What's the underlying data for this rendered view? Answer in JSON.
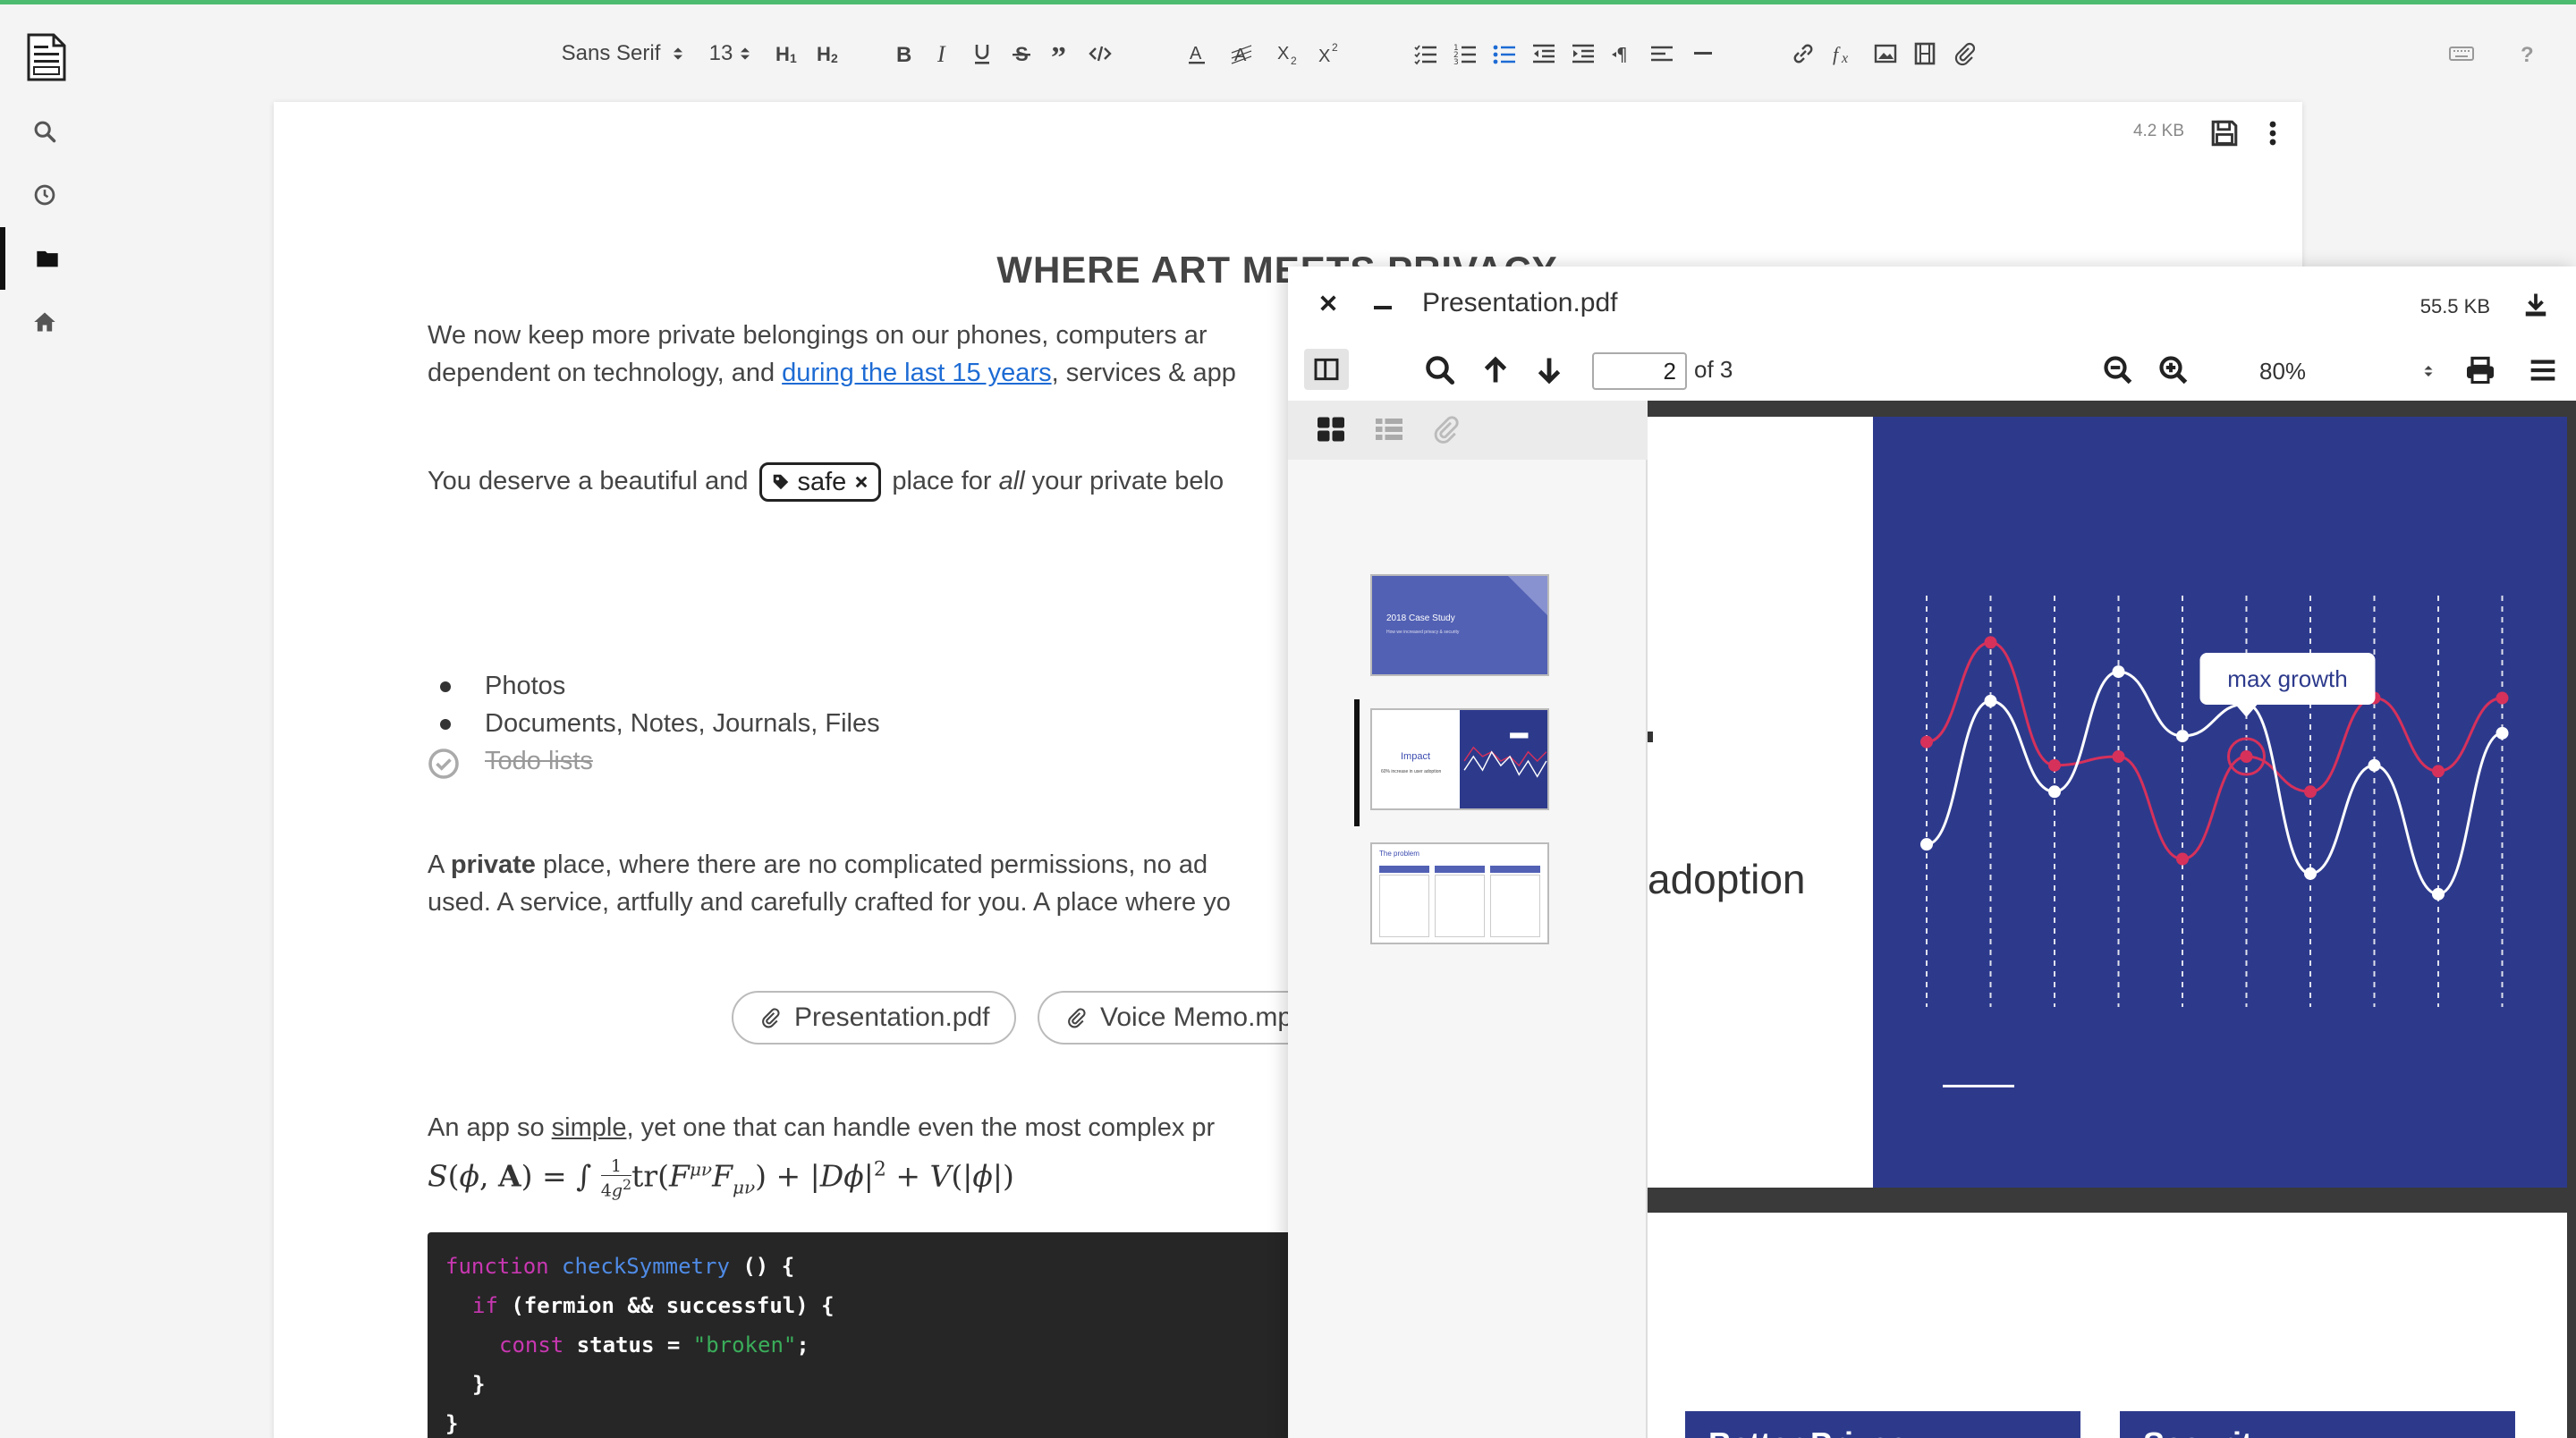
{
  "toolbar": {
    "font_family": "Sans Serif",
    "font_size": "13",
    "zoom_icon_names": [
      "keyboard-icon",
      "help-icon"
    ]
  },
  "document": {
    "size": "4.2 KB",
    "title": "WHERE ART MEETS PRIVACY",
    "para1_line1": "We now keep more private belongings on our phones, computers ar",
    "para1_line2_pre": "dependent on technology, and ",
    "para1_link": "during the last 15 years",
    "para1_line2_post": ", services & app",
    "para2_pre": "You deserve a beautiful and",
    "para2_tag": "safe",
    "para2_mid": "place for ",
    "para2_em": "all",
    "para2_post": " your private belo",
    "list": [
      "Photos",
      "Documents, Notes, Journals, Files"
    ],
    "done_item": "Todo lists",
    "para3_pre": "A ",
    "para3_bold": "private",
    "para3_post": " place, where there are no complicated permissions, no ad",
    "para3_line2": "used. A service, artfully and carefully crafted for you. A place where yo",
    "attachments": [
      "Presentation.pdf",
      "Voice Memo.mp"
    ],
    "para4_pre": "An app so ",
    "para4_u": "simple",
    "para4_post": ", yet one that can handle even the most complex pr",
    "code": {
      "l1_kw": "function",
      "l1_fn": "checkSymmetry",
      "l1_rest": " () {",
      "l2_kw": "if",
      "l2_rest": " (fermion && successful) {",
      "l3_kw": "const",
      "l3_var": " status = ",
      "l3_str": "\"broken\"",
      "l3_end": ";",
      "l4": "}",
      "l5": "}"
    }
  },
  "pdf": {
    "filename": "Presentation.pdf",
    "size": "55.5 KB",
    "page": "2",
    "of": "of 3",
    "zoom": "80%",
    "page_text": "adoption",
    "tooltip": "max growth",
    "thumb1_title": "2018 Case Study",
    "thumb1_sub": "How we increased privacy & security",
    "thumb2_title": "Impact",
    "thumb2_sub": "60% increase in user adoption",
    "thumb3_title": "The problem",
    "card1": "Better Privacy",
    "card2": "Security"
  },
  "colors": {
    "accent_bar": "#4dbb6f",
    "link": "#1d6bd4",
    "slide_blue": "#2d3a8c",
    "series_red": "#d6315b",
    "series_white": "#ffffff"
  },
  "chart_data": {
    "type": "line",
    "series": [
      {
        "values": [
          5.0,
          8.4,
          4.2,
          4.5,
          1.0,
          4.5,
          3.3,
          6.5,
          4.0,
          6.5
        ]
      },
      {
        "values": [
          1.5,
          6.4,
          3.3,
          7.4,
          5.2,
          6.3,
          0.5,
          4.2,
          -0.2,
          5.3
        ]
      }
    ],
    "annotation": "max growth"
  }
}
